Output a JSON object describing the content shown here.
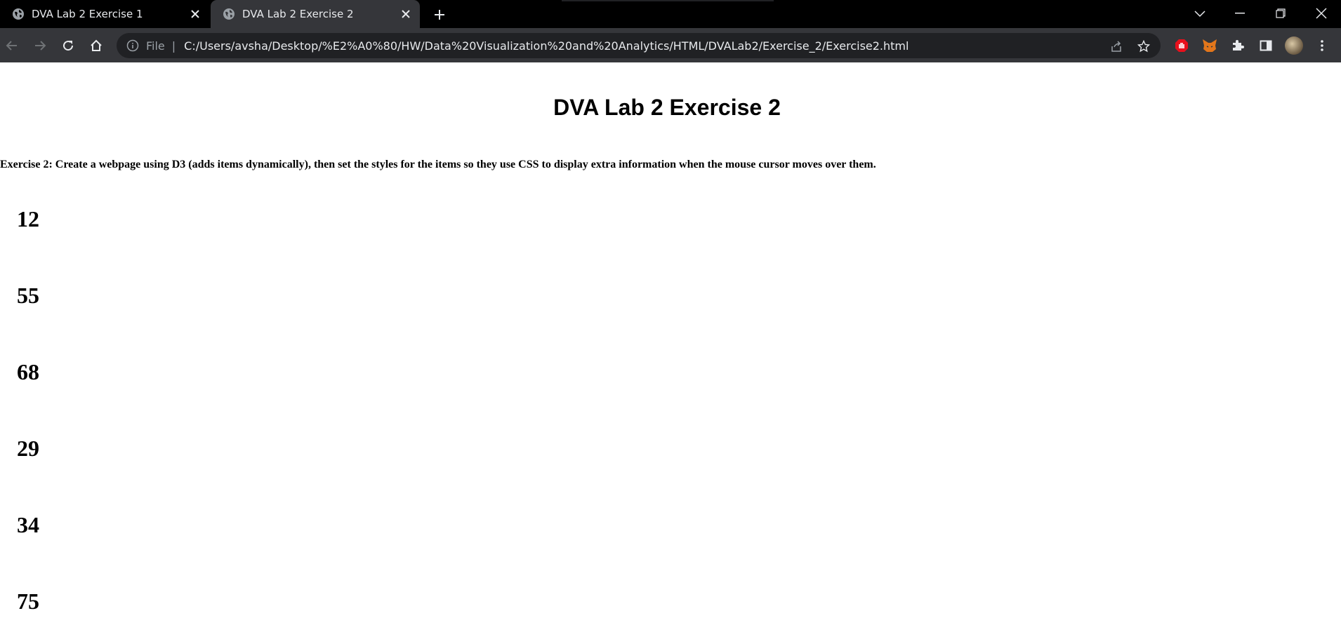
{
  "browser": {
    "tabs": [
      {
        "title": "DVA Lab 2 Exercise 1",
        "active": false,
        "icon": "globe-icon"
      },
      {
        "title": "DVA Lab 2 Exercise 2",
        "active": true,
        "icon": "globe-icon"
      }
    ],
    "address_bar": {
      "scheme_label": "File",
      "url": "C:/Users/avsha/Desktop/%E2%A0%80/HW/Data%20Visualization%20and%20Analytics/HTML/DVALab2/Exercise_2/Exercise2.html"
    }
  },
  "page": {
    "heading": "DVA Lab 2 Exercise 2",
    "description": "Exercise 2: Create a webpage using D3 (adds items dynamically), then set the styles for the items so they use CSS to display extra information when the mouse cursor moves over them.",
    "items": [
      "12",
      "55",
      "68",
      "29",
      "34",
      "75"
    ]
  }
}
